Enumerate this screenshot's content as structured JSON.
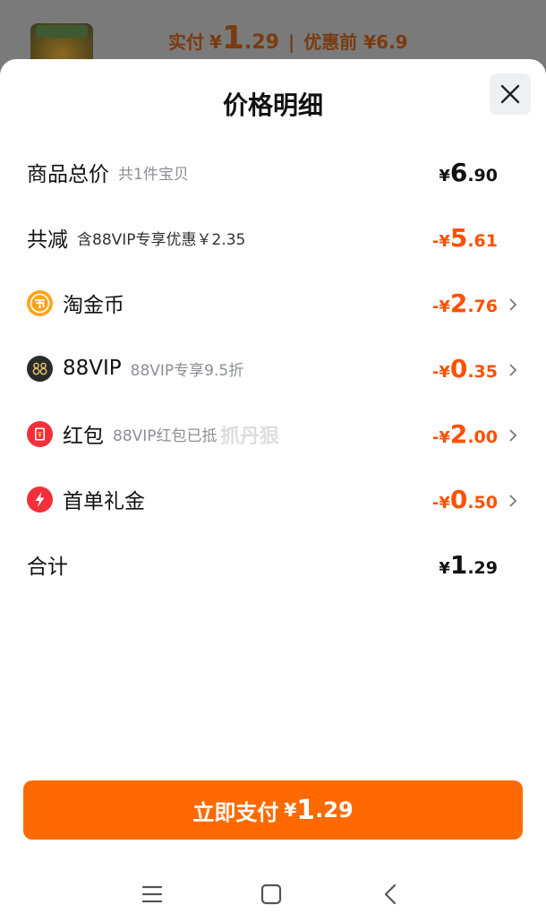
{
  "background_page": {
    "paid_label": "实付",
    "paid_yen": "¥",
    "paid_int": "1",
    "paid_dec": ".29",
    "separator": "|",
    "original_label": "优惠前 ¥6.9"
  },
  "sheet": {
    "title": "价格明细",
    "close_icon": "close-icon"
  },
  "rows": {
    "total": {
      "label": "商品总价",
      "sub": "共1件宝贝",
      "prefix": "¥",
      "int": "6",
      "dec": ".90"
    },
    "reduction": {
      "label": "共减",
      "sub": "含88VIP专享优惠￥2.35",
      "prefix": "-¥",
      "int": "5",
      "dec": ".61"
    },
    "coins": {
      "label": "淘金币",
      "sub": "",
      "prefix": "-¥",
      "int": "2",
      "dec": ".76",
      "icon": "coin-icon"
    },
    "vip": {
      "label": "88VIP",
      "sub": "88VIP专享9.5折",
      "prefix": "-¥",
      "int": "0",
      "dec": ".35",
      "icon": "vip-88-icon"
    },
    "redpacket": {
      "label": "红包",
      "sub": "88VIP红包已抵",
      "prefix": "-¥",
      "int": "2",
      "dec": ".00",
      "icon": "red-packet-icon"
    },
    "firstorder": {
      "label": "首单礼金",
      "sub": "",
      "prefix": "-¥",
      "int": "0",
      "dec": ".50",
      "icon": "lightning-icon"
    },
    "sum": {
      "label": "合计",
      "prefix": "¥",
      "int": "1",
      "dec": ".29"
    }
  },
  "watermark": "抓丹狠",
  "pay_button": {
    "label": "立即支付",
    "yen": "¥",
    "int": "1",
    "dec": ".29"
  },
  "colors": {
    "accent": "#ff6a00",
    "discount": "#ff5000",
    "text": "#111111",
    "muted": "#8c8f96"
  },
  "navbar": {
    "menu_icon": "menu-icon",
    "home_icon": "home-icon",
    "back_icon": "back-icon"
  }
}
